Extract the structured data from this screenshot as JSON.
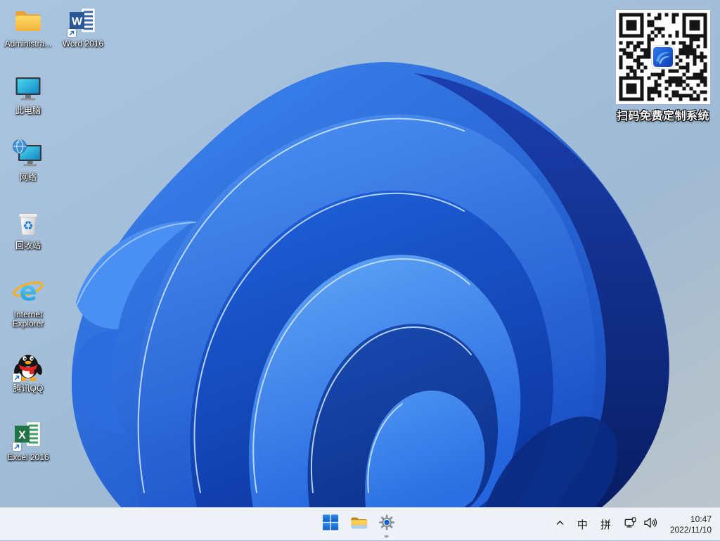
{
  "desktop": {
    "icons": [
      {
        "name": "administrator-folder",
        "label": "Administra..."
      },
      {
        "name": "word-2016",
        "label": "Word 2016"
      },
      {
        "name": "this-pc",
        "label": "此电脑"
      },
      {
        "name": "network",
        "label": "网络"
      },
      {
        "name": "recycle-bin",
        "label": "回收站"
      },
      {
        "name": "internet-explorer",
        "label": "Internet Explorer"
      },
      {
        "name": "tencent-qq",
        "label": "腾讯QQ"
      },
      {
        "name": "excel-2016",
        "label": "Excel 2016"
      }
    ],
    "qr_caption": "扫码免费定制系统"
  },
  "taskbar": {
    "tray": {
      "ime_mode": "中",
      "ime_layout": "拼",
      "time": "10:47",
      "date": "2022/11/10"
    }
  },
  "colors": {
    "taskbar_bg": "#eef1f6",
    "sky_top": "#aac4de",
    "sky_bottom": "#bbc5cd",
    "bloom_bright": "#2f7bf0",
    "bloom_dark": "#0c2f8c",
    "accent_blue": "#1466c8"
  }
}
